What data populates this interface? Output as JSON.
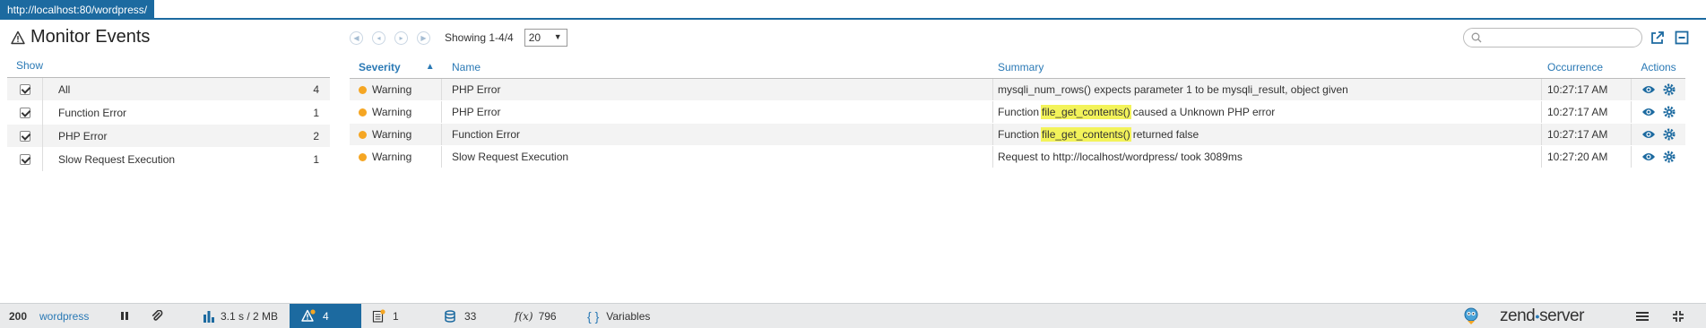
{
  "url": "http://localhost:80/wordpress/",
  "page_title": "Monitor Events",
  "filters": {
    "header": "Show",
    "items": [
      {
        "label": "All",
        "count": "4",
        "checked": true
      },
      {
        "label": "Function Error",
        "count": "1",
        "checked": true
      },
      {
        "label": "PHP Error",
        "count": "2",
        "checked": true
      },
      {
        "label": "Slow Request Execution",
        "count": "1",
        "checked": true
      }
    ]
  },
  "pager": {
    "showing": "Showing 1-4/4",
    "page_size": "20"
  },
  "search": {
    "placeholder": ""
  },
  "table": {
    "headers": {
      "severity": "Severity",
      "name": "Name",
      "summary": "Summary",
      "occurrence": "Occurrence",
      "actions": "Actions"
    },
    "rows": [
      {
        "severity": "Warning",
        "name": "PHP Error",
        "summary_pre": "mysqli_num_rows() expects parameter 1 to be mysqli_result, object given",
        "summary_hl": "",
        "summary_post": "",
        "occurrence": "10:27:17 AM"
      },
      {
        "severity": "Warning",
        "name": "PHP Error",
        "summary_pre": "Function",
        "summary_hl": "file_get_contents()",
        "summary_post": "caused a Unknown PHP error",
        "occurrence": "10:27:17 AM"
      },
      {
        "severity": "Warning",
        "name": "Function Error",
        "summary_pre": "Function",
        "summary_hl": "file_get_contents()",
        "summary_post": "returned false",
        "occurrence": "10:27:17 AM"
      },
      {
        "severity": "Warning",
        "name": "Slow Request Execution",
        "summary_pre": "Request to http://localhost/wordpress/ took 3089ms",
        "summary_hl": "",
        "summary_post": "",
        "occurrence": "10:27:20 AM"
      }
    ]
  },
  "toolbar": {
    "status_code": "200",
    "app_name": "wordpress",
    "perf": "3.1 s / 2 MB",
    "events_count": "4",
    "code_count": "1",
    "db_count": "33",
    "functions_count": "796",
    "fx_label": "f(x)",
    "variables_label": "Variables",
    "brand": "zend",
    "brand_suffix": "server"
  },
  "colors": {
    "accent": "#1c6aa0",
    "link": "#2a79b5",
    "warning": "#f5a623",
    "highlight": "#f3f35a"
  }
}
